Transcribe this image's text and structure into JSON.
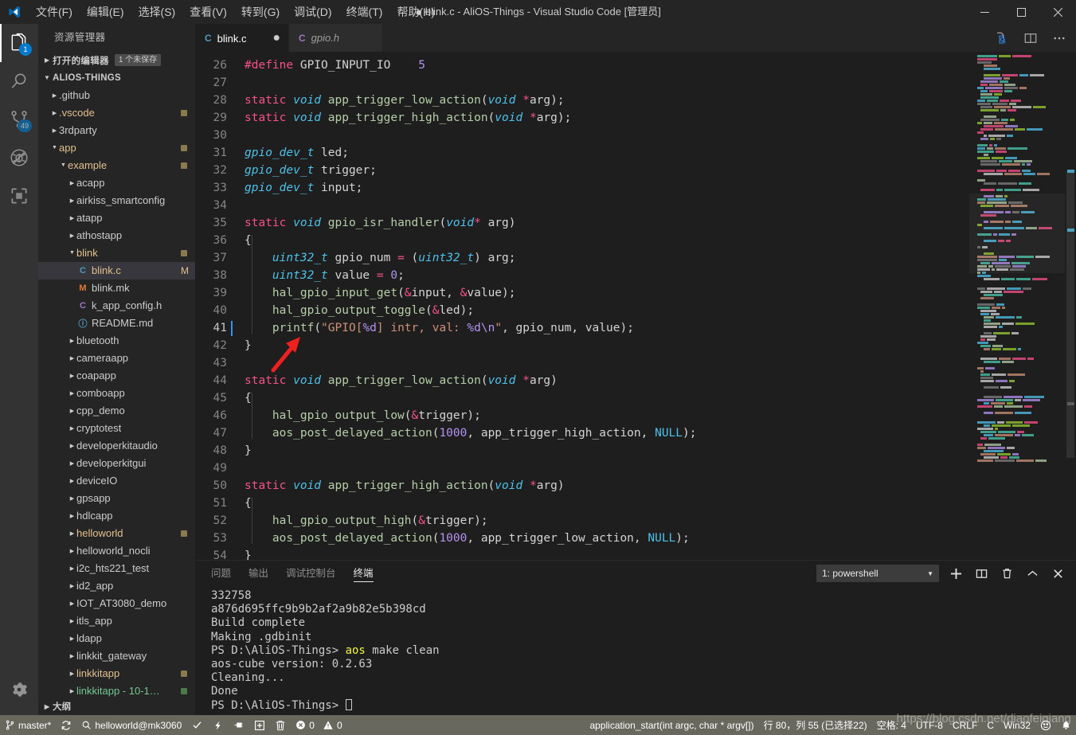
{
  "window": {
    "title": "blink.c - AliOS-Things - Visual Studio Code [管理员]",
    "dirty_dot": "●",
    "minimize": "─",
    "maximize": "☐",
    "close": "✕"
  },
  "menubar": {
    "items": [
      {
        "label": "文件(F)",
        "name": "menu-file"
      },
      {
        "label": "编辑(E)",
        "name": "menu-edit"
      },
      {
        "label": "选择(S)",
        "name": "menu-selection"
      },
      {
        "label": "查看(V)",
        "name": "menu-view"
      },
      {
        "label": "转到(G)",
        "name": "menu-go"
      },
      {
        "label": "调试(D)",
        "name": "menu-debug"
      },
      {
        "label": "终端(T)",
        "name": "menu-terminal"
      },
      {
        "label": "帮助(H)",
        "name": "menu-help"
      }
    ]
  },
  "activitybar": {
    "items": [
      {
        "icon": "explorer-icon",
        "badge": "1",
        "active": true
      },
      {
        "icon": "search-icon",
        "badge": ""
      },
      {
        "icon": "source-control-icon",
        "badge": "49"
      },
      {
        "icon": "debug-icon",
        "badge": ""
      },
      {
        "icon": "extensions-icon",
        "badge": ""
      }
    ],
    "settings_icon": "gear-icon"
  },
  "sidebar": {
    "title": "资源管理器",
    "open_editors": {
      "label": "打开的编辑器",
      "badge": "1 个未保存"
    },
    "workspace": {
      "label": "ALIOS-THINGS"
    },
    "outline": {
      "label": "大纲"
    },
    "tree": [
      {
        "label": ".github",
        "indent": 1,
        "type": "folder",
        "expanded": false,
        "color": "#cccccc",
        "dot": ""
      },
      {
        "label": ".vscode",
        "indent": 1,
        "type": "folder",
        "expanded": false,
        "color": "#e2c08d",
        "dot": "yellow"
      },
      {
        "label": "3rdparty",
        "indent": 1,
        "type": "folder",
        "expanded": false,
        "color": "#cccccc",
        "dot": ""
      },
      {
        "label": "app",
        "indent": 1,
        "type": "folder",
        "expanded": true,
        "color": "#e2c08d",
        "dot": "yellow"
      },
      {
        "label": "example",
        "indent": 2,
        "type": "folder",
        "expanded": true,
        "color": "#e2c08d",
        "dot": "yellow"
      },
      {
        "label": "acapp",
        "indent": 3,
        "type": "folder",
        "expanded": false,
        "color": "#cccccc",
        "dot": ""
      },
      {
        "label": "airkiss_smartconfig",
        "indent": 3,
        "type": "folder",
        "expanded": false,
        "color": "#cccccc",
        "dot": ""
      },
      {
        "label": "atapp",
        "indent": 3,
        "type": "folder",
        "expanded": false,
        "color": "#cccccc",
        "dot": ""
      },
      {
        "label": "athostapp",
        "indent": 3,
        "type": "folder",
        "expanded": false,
        "color": "#cccccc",
        "dot": ""
      },
      {
        "label": "blink",
        "indent": 3,
        "type": "folder",
        "expanded": true,
        "color": "#e2c08d",
        "dot": "yellow"
      },
      {
        "label": "blink.c",
        "indent": 4,
        "type": "c",
        "expanded": false,
        "color": "#e2c08d",
        "dot": "",
        "marker": "M",
        "selected": true
      },
      {
        "label": "blink.mk",
        "indent": 4,
        "type": "mk",
        "expanded": false,
        "color": "#cccccc",
        "dot": ""
      },
      {
        "label": "k_app_config.h",
        "indent": 4,
        "type": "h",
        "expanded": false,
        "color": "#cccccc",
        "dot": ""
      },
      {
        "label": "README.md",
        "indent": 4,
        "type": "md",
        "expanded": false,
        "color": "#cccccc",
        "dot": ""
      },
      {
        "label": "bluetooth",
        "indent": 3,
        "type": "folder",
        "expanded": false,
        "color": "#cccccc",
        "dot": ""
      },
      {
        "label": "cameraapp",
        "indent": 3,
        "type": "folder",
        "expanded": false,
        "color": "#cccccc",
        "dot": ""
      },
      {
        "label": "coapapp",
        "indent": 3,
        "type": "folder",
        "expanded": false,
        "color": "#cccccc",
        "dot": ""
      },
      {
        "label": "comboapp",
        "indent": 3,
        "type": "folder",
        "expanded": false,
        "color": "#cccccc",
        "dot": ""
      },
      {
        "label": "cpp_demo",
        "indent": 3,
        "type": "folder",
        "expanded": false,
        "color": "#cccccc",
        "dot": ""
      },
      {
        "label": "cryptotest",
        "indent": 3,
        "type": "folder",
        "expanded": false,
        "color": "#cccccc",
        "dot": ""
      },
      {
        "label": "developerkitaudio",
        "indent": 3,
        "type": "folder",
        "expanded": false,
        "color": "#cccccc",
        "dot": ""
      },
      {
        "label": "developerkitgui",
        "indent": 3,
        "type": "folder",
        "expanded": false,
        "color": "#cccccc",
        "dot": ""
      },
      {
        "label": "deviceIO",
        "indent": 3,
        "type": "folder",
        "expanded": false,
        "color": "#cccccc",
        "dot": ""
      },
      {
        "label": "gpsapp",
        "indent": 3,
        "type": "folder",
        "expanded": false,
        "color": "#cccccc",
        "dot": ""
      },
      {
        "label": "hdlcapp",
        "indent": 3,
        "type": "folder",
        "expanded": false,
        "color": "#cccccc",
        "dot": ""
      },
      {
        "label": "helloworld",
        "indent": 3,
        "type": "folder",
        "expanded": false,
        "color": "#e2c08d",
        "dot": "yellow"
      },
      {
        "label": "helloworld_nocli",
        "indent": 3,
        "type": "folder",
        "expanded": false,
        "color": "#cccccc",
        "dot": ""
      },
      {
        "label": "i2c_hts221_test",
        "indent": 3,
        "type": "folder",
        "expanded": false,
        "color": "#cccccc",
        "dot": ""
      },
      {
        "label": "id2_app",
        "indent": 3,
        "type": "folder",
        "expanded": false,
        "color": "#cccccc",
        "dot": ""
      },
      {
        "label": "IOT_AT3080_demo",
        "indent": 3,
        "type": "folder",
        "expanded": false,
        "color": "#cccccc",
        "dot": ""
      },
      {
        "label": "itls_app",
        "indent": 3,
        "type": "folder",
        "expanded": false,
        "color": "#cccccc",
        "dot": ""
      },
      {
        "label": "ldapp",
        "indent": 3,
        "type": "folder",
        "expanded": false,
        "color": "#cccccc",
        "dot": ""
      },
      {
        "label": "linkkit_gateway",
        "indent": 3,
        "type": "folder",
        "expanded": false,
        "color": "#cccccc",
        "dot": ""
      },
      {
        "label": "linkkitapp",
        "indent": 3,
        "type": "folder",
        "expanded": false,
        "color": "#e2c08d",
        "dot": "yellow"
      },
      {
        "label": "linkkitapp - 10-1…",
        "indent": 3,
        "type": "folder",
        "expanded": false,
        "color": "#73c991",
        "dot": "green"
      }
    ]
  },
  "tabs": {
    "items": [
      {
        "label": "blink.c",
        "icon": "c-file-icon",
        "icon_color": "#519aba",
        "active": true,
        "dirty": true,
        "italic": false
      },
      {
        "label": "gpio.h",
        "icon": "c-file-icon",
        "icon_color": "#a074c4",
        "active": false,
        "dirty": false,
        "italic": true
      }
    ],
    "actions": [
      {
        "name": "open-changes-icon"
      },
      {
        "name": "split-editor-icon"
      },
      {
        "name": "more-actions-icon"
      }
    ]
  },
  "editor": {
    "cursor_line": 41,
    "lines": [
      {
        "no": 26,
        "tokens": [
          [
            "pre",
            "#define "
          ],
          [
            "macroname",
            "GPIO_INPUT_IO"
          ],
          [
            "op",
            "    "
          ],
          [
            "num",
            "5"
          ]
        ]
      },
      {
        "no": 27,
        "tokens": []
      },
      {
        "no": 28,
        "tokens": [
          [
            "kw",
            "static "
          ],
          [
            "typ2",
            "void "
          ],
          [
            "fn",
            "app_trigger_low_action"
          ],
          [
            "op",
            "("
          ],
          [
            "typ2",
            "void "
          ],
          [
            "amp",
            "*"
          ],
          [
            "var",
            "arg"
          ],
          [
            "op",
            ");"
          ]
        ]
      },
      {
        "no": 29,
        "tokens": [
          [
            "kw",
            "static "
          ],
          [
            "typ2",
            "void "
          ],
          [
            "fn",
            "app_trigger_high_action"
          ],
          [
            "op",
            "("
          ],
          [
            "typ2",
            "void "
          ],
          [
            "amp",
            "*"
          ],
          [
            "var",
            "arg"
          ],
          [
            "op",
            ");"
          ]
        ]
      },
      {
        "no": 30,
        "tokens": []
      },
      {
        "no": 31,
        "tokens": [
          [
            "typ2",
            "gpio_dev_t "
          ],
          [
            "var",
            "led;"
          ]
        ]
      },
      {
        "no": 32,
        "tokens": [
          [
            "typ2",
            "gpio_dev_t "
          ],
          [
            "var",
            "trigger;"
          ]
        ]
      },
      {
        "no": 33,
        "tokens": [
          [
            "typ2",
            "gpio_dev_t "
          ],
          [
            "var",
            "input;"
          ]
        ]
      },
      {
        "no": 34,
        "tokens": []
      },
      {
        "no": 35,
        "tokens": [
          [
            "kw",
            "static "
          ],
          [
            "typ2",
            "void "
          ],
          [
            "fn",
            "gpio_isr_handler"
          ],
          [
            "op",
            "("
          ],
          [
            "typ2",
            "void"
          ],
          [
            "amp",
            "*"
          ],
          [
            "var",
            " arg"
          ],
          [
            "op",
            ")"
          ]
        ]
      },
      {
        "no": 36,
        "tokens": [
          [
            "op",
            "{"
          ]
        ]
      },
      {
        "no": 37,
        "tokens": [
          [
            "op",
            "    "
          ],
          [
            "typ2",
            "uint32_t "
          ],
          [
            "var",
            "gpio_num "
          ],
          [
            "amp",
            "= "
          ],
          [
            "op",
            "("
          ],
          [
            "typ2",
            "uint32_t"
          ],
          [
            "op",
            ") "
          ],
          [
            "var",
            "arg;"
          ]
        ]
      },
      {
        "no": 38,
        "tokens": [
          [
            "op",
            "    "
          ],
          [
            "typ2",
            "uint32_t "
          ],
          [
            "var",
            "value "
          ],
          [
            "amp",
            "= "
          ],
          [
            "num",
            "0"
          ],
          [
            "op",
            ";"
          ]
        ]
      },
      {
        "no": 39,
        "tokens": [
          [
            "op",
            "    "
          ],
          [
            "fn",
            "hal_gpio_input_get"
          ],
          [
            "op",
            "("
          ],
          [
            "amp",
            "&"
          ],
          [
            "var",
            "input, "
          ],
          [
            "amp",
            "&"
          ],
          [
            "var",
            "value"
          ],
          [
            "op",
            ");"
          ]
        ]
      },
      {
        "no": 40,
        "tokens": [
          [
            "op",
            "    "
          ],
          [
            "fn",
            "hal_gpio_output_toggle"
          ],
          [
            "op",
            "("
          ],
          [
            "amp",
            "&"
          ],
          [
            "var",
            "led"
          ],
          [
            "op",
            ");"
          ]
        ]
      },
      {
        "no": 41,
        "tokens": [
          [
            "op",
            "    "
          ],
          [
            "fn",
            "printf"
          ],
          [
            "op",
            "("
          ],
          [
            "str",
            "\"GPIO["
          ],
          [
            "esc",
            "%d"
          ],
          [
            "str",
            "] intr, val: "
          ],
          [
            "esc",
            "%d\\n"
          ],
          [
            "str",
            "\""
          ],
          [
            "op",
            ", "
          ],
          [
            "var",
            "gpio_num, value"
          ],
          [
            "op",
            ");"
          ]
        ]
      },
      {
        "no": 42,
        "tokens": [
          [
            "op",
            "}"
          ]
        ]
      },
      {
        "no": 43,
        "tokens": []
      },
      {
        "no": 44,
        "tokens": [
          [
            "kw",
            "static "
          ],
          [
            "typ2",
            "void "
          ],
          [
            "fn",
            "app_trigger_low_action"
          ],
          [
            "op",
            "("
          ],
          [
            "typ2",
            "void "
          ],
          [
            "amp",
            "*"
          ],
          [
            "var",
            "arg"
          ],
          [
            "op",
            ")"
          ]
        ]
      },
      {
        "no": 45,
        "tokens": [
          [
            "op",
            "{"
          ]
        ]
      },
      {
        "no": 46,
        "tokens": [
          [
            "op",
            "    "
          ],
          [
            "fn",
            "hal_gpio_output_low"
          ],
          [
            "op",
            "("
          ],
          [
            "amp",
            "&"
          ],
          [
            "var",
            "trigger"
          ],
          [
            "op",
            ");"
          ]
        ]
      },
      {
        "no": 47,
        "tokens": [
          [
            "op",
            "    "
          ],
          [
            "fn",
            "aos_post_delayed_action"
          ],
          [
            "op",
            "("
          ],
          [
            "num",
            "1000"
          ],
          [
            "op",
            ", "
          ],
          [
            "var",
            "app_trigger_high_action, "
          ],
          [
            "nul",
            "NULL"
          ],
          [
            "op",
            ");"
          ]
        ]
      },
      {
        "no": 48,
        "tokens": [
          [
            "op",
            "}"
          ]
        ]
      },
      {
        "no": 49,
        "tokens": []
      },
      {
        "no": 50,
        "tokens": [
          [
            "kw",
            "static "
          ],
          [
            "typ2",
            "void "
          ],
          [
            "fn",
            "app_trigger_high_action"
          ],
          [
            "op",
            "("
          ],
          [
            "typ2",
            "void "
          ],
          [
            "amp",
            "*"
          ],
          [
            "var",
            "arg"
          ],
          [
            "op",
            ")"
          ]
        ]
      },
      {
        "no": 51,
        "tokens": [
          [
            "op",
            "{"
          ]
        ]
      },
      {
        "no": 52,
        "tokens": [
          [
            "op",
            "    "
          ],
          [
            "fn",
            "hal_gpio_output_high"
          ],
          [
            "op",
            "("
          ],
          [
            "amp",
            "&"
          ],
          [
            "var",
            "trigger"
          ],
          [
            "op",
            ");"
          ]
        ]
      },
      {
        "no": 53,
        "tokens": [
          [
            "op",
            "    "
          ],
          [
            "fn",
            "aos_post_delayed_action"
          ],
          [
            "op",
            "("
          ],
          [
            "num",
            "1000"
          ],
          [
            "op",
            ", "
          ],
          [
            "var",
            "app_trigger_low_action, "
          ],
          [
            "nul",
            "NULL"
          ],
          [
            "op",
            ");"
          ]
        ]
      },
      {
        "no": 54,
        "tokens": [
          [
            "op",
            "}"
          ]
        ]
      }
    ]
  },
  "panel": {
    "tabs": [
      {
        "label": "问题",
        "active": false
      },
      {
        "label": "输出",
        "active": false
      },
      {
        "label": "调试控制台",
        "active": false
      },
      {
        "label": "终端",
        "active": true
      }
    ],
    "terminal_select": "1: powershell",
    "actions": [
      {
        "name": "new-terminal-icon",
        "glyph": "+"
      },
      {
        "name": "split-terminal-icon",
        "glyph": "▯▯"
      },
      {
        "name": "kill-terminal-icon",
        "glyph": "🗑"
      },
      {
        "name": "maximize-panel-icon",
        "glyph": "^"
      },
      {
        "name": "close-panel-icon",
        "glyph": "✕"
      }
    ],
    "terminal_lines": [
      {
        "text": "332758"
      },
      {
        "text": "a876d695ffc9b9b2af2a9b82e5b398cd"
      },
      {
        "text": "Build complete"
      },
      {
        "text": "Making .gdbinit"
      },
      {
        "prefix": "PS D:\\AliOS-Things> ",
        "highlight": "aos",
        "suffix": " make clean"
      },
      {
        "text": "aos-cube version: 0.2.63"
      },
      {
        "text": "Cleaning..."
      },
      {
        "text": "Done"
      },
      {
        "prefix": "PS D:\\AliOS-Things> ",
        "cursor": true
      }
    ]
  },
  "statusbar": {
    "branch": "master*",
    "sync_icon": "sync-icon",
    "target": "helloworld@mk3060",
    "build_icon": "check-icon",
    "flash_icon": "lightning-icon",
    "monitor_icon": "plug-icon",
    "add_icon": "new-file-icon",
    "clean_icon": "trash-icon",
    "errors": "0",
    "warnings": "0",
    "breadcrumb": "application_start(int argc, char * argv[])",
    "position": "行 80，列 55 (已选择22)",
    "spaces": "空格: 4",
    "encoding": "UTF-8",
    "eol": "CRLF",
    "language": "C",
    "platform": "Win32",
    "feedback_icon": "smiley-icon",
    "bell_icon": "bell-icon",
    "watermark": "https://blog.csdn.net/diaofeigiang"
  },
  "colors": {
    "accent": "#007acc",
    "statusbar_bg": "#68685f",
    "sidebar_bg": "#252526",
    "editor_bg": "#1e1e1e",
    "activitybar_bg": "#333333"
  }
}
